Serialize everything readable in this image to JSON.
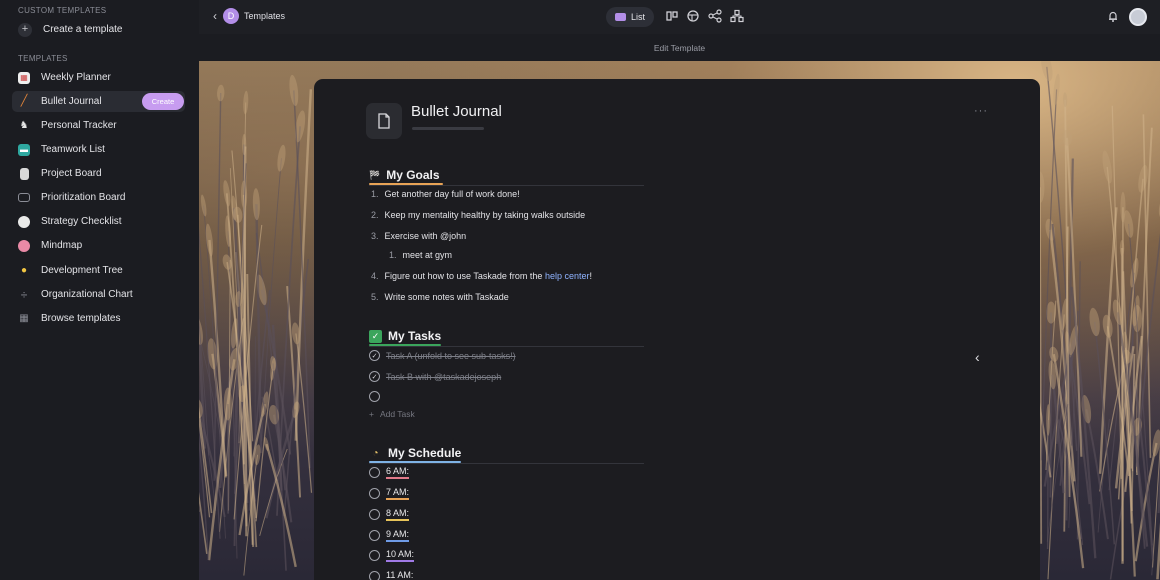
{
  "sidebar": {
    "custom_section": "CUSTOM TEMPLATES",
    "create_template": "Create a template",
    "templates_section": "TEMPLATES",
    "create_pill": "Create",
    "items": [
      {
        "label": "Weekly Planner",
        "icon": "calendar-icon",
        "color": "#e7e7e7"
      },
      {
        "label": "Bullet Journal",
        "icon": "pencil-icon",
        "color": "#e0843a"
      },
      {
        "label": "Personal Tracker",
        "icon": "person-walking-icon",
        "color": "#e6e6e6"
      },
      {
        "label": "Teamwork List",
        "icon": "team-icon",
        "color": "#2ea8a0"
      },
      {
        "label": "Project Board",
        "icon": "clipboard-icon",
        "color": "#d9d9d9"
      },
      {
        "label": "Prioritization Board",
        "icon": "monitor-icon",
        "color": "#8b8d96"
      },
      {
        "label": "Strategy Checklist",
        "icon": "speech-bubble-icon",
        "color": "#e9e9e9"
      },
      {
        "label": "Mindmap",
        "icon": "brain-icon",
        "color": "#e98aa6"
      },
      {
        "label": "Development Tree",
        "icon": "lightbulb-icon",
        "color": "#f1c542"
      },
      {
        "label": "Organizational Chart",
        "icon": "divide-icon",
        "color": "#8b8d96"
      },
      {
        "label": "Browse templates",
        "icon": "grid-icon",
        "color": "#8b8d96"
      }
    ]
  },
  "topbar": {
    "breadcrumb_initial": "D",
    "breadcrumb_label": "Templates",
    "view_label": "List"
  },
  "editbar": {
    "label": "Edit Template"
  },
  "document": {
    "title": "Bullet Journal",
    "more": "···",
    "goals": {
      "heading": "My Goals",
      "items": [
        {
          "num": "1.",
          "text": "Get another day full of work done!"
        },
        {
          "num": "2.",
          "text": "Keep my mentality healthy by taking walks outside"
        },
        {
          "num": "3.",
          "text": "Exercise with @john"
        },
        {
          "num": "1.",
          "text": "meet at gym"
        },
        {
          "num": "4.",
          "text_before": "Figure out how to use Taskade from the ",
          "link": "help center",
          "text_after": "!"
        },
        {
          "num": "5.",
          "text": "Write some notes with Taskade"
        }
      ]
    },
    "tasks": {
      "heading": "My Tasks",
      "items": [
        {
          "text": "Task A (unfold to see sub-tasks!)",
          "done": true
        },
        {
          "text": "Task B with @taskadejoseph",
          "done": true
        },
        {
          "text": "",
          "done": false
        }
      ],
      "add_label": "Add Task"
    },
    "schedule": {
      "heading": "My Schedule",
      "times": [
        {
          "label": "6 AM:",
          "color": "#e07a8a"
        },
        {
          "label": "7 AM:",
          "color": "#e7a356"
        },
        {
          "label": "8 AM:",
          "color": "#e6c35a"
        },
        {
          "label": "9 AM:",
          "color": "#6f9be6"
        },
        {
          "label": "10 AM:",
          "color": "#a07ae6"
        },
        {
          "label": "11 AM:",
          "color": "#e07a8a"
        }
      ]
    }
  }
}
